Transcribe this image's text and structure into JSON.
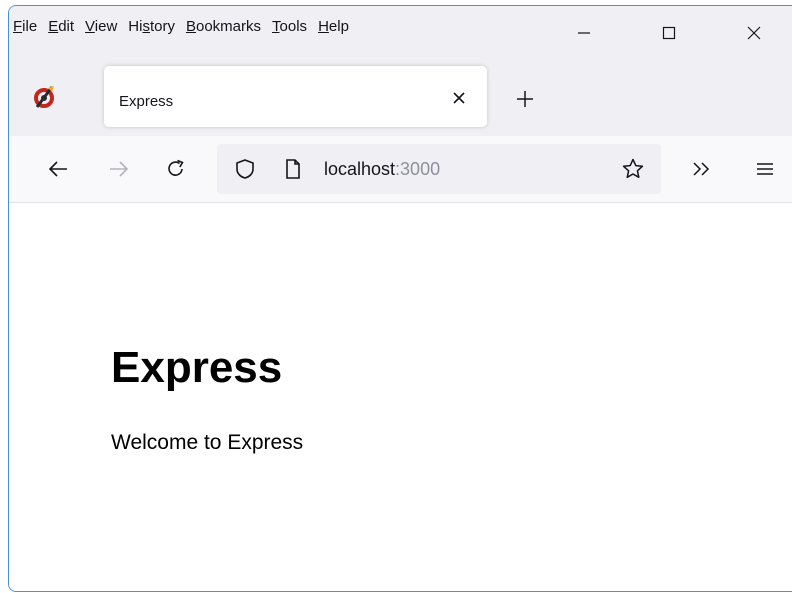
{
  "menubar": {
    "items": [
      {
        "label": "File",
        "accel": "F",
        "rest": "ile"
      },
      {
        "label": "Edit",
        "accel": "E",
        "rest": "dit"
      },
      {
        "label": "View",
        "accel": "V",
        "rest": "iew"
      },
      {
        "label": "History",
        "pre": "Hi",
        "accel": "s",
        "rest": "tory"
      },
      {
        "label": "Bookmarks",
        "accel": "B",
        "rest": "ookmarks"
      },
      {
        "label": "Tools",
        "accel": "T",
        "rest": "ools"
      },
      {
        "label": "Help",
        "accel": "H",
        "rest": "elp"
      }
    ]
  },
  "window_controls": {
    "minimize": "—",
    "maximize": "☐",
    "close": "✕"
  },
  "tabs": [
    {
      "title": "Express",
      "close": "✕"
    }
  ],
  "new_tab": "+",
  "urlbar": {
    "host": "localhost",
    "port": ":3000"
  },
  "page": {
    "heading": "Express",
    "text": "Welcome to Express"
  },
  "colors": {
    "window_border": "#4a90d9",
    "titlebar_bg": "#f0f0f4",
    "navbar_bg": "#f9f9fb",
    "urlbar_bg": "#f0f0f4"
  },
  "icons": {
    "app": "firefox-nightly-icon",
    "back": "arrow-left-icon",
    "forward": "arrow-right-icon",
    "reload": "reload-icon",
    "shield": "shield-icon",
    "page": "page-icon",
    "bookmark": "star-icon",
    "overflow": "chevron-double-right-icon",
    "menu": "hamburger-menu-icon"
  }
}
